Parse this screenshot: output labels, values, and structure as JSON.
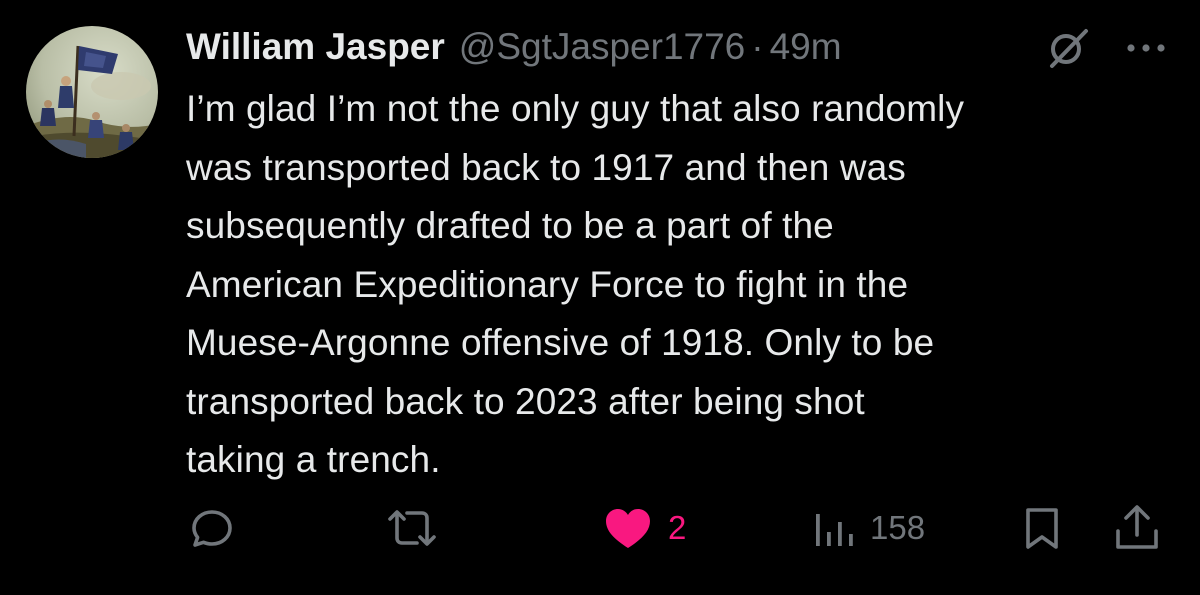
{
  "tweet": {
    "author": {
      "display_name": "William Jasper",
      "handle": "@SgtJasper1776",
      "separator": "·",
      "time": "49m"
    },
    "text_lines": [
      "I’m glad I’m not the only guy that also randomly",
      "was transported back to 1917 and then was",
      "subsequently drafted to be a part of the",
      "American Expeditionary Force to fight in the",
      "Muese-Argonne offensive of 1918. Only to be",
      "transported back to 2023 after being shot",
      "taking a trench."
    ],
    "header_icons": [
      "grok-icon",
      "more-icon"
    ],
    "actions": {
      "reply": {
        "icon": "reply-icon",
        "count": ""
      },
      "retweet": {
        "icon": "retweet-icon",
        "count": ""
      },
      "like": {
        "icon": "heart-icon",
        "count": "2",
        "active": true
      },
      "views": {
        "icon": "views-icon",
        "count": "158"
      },
      "bookmark": {
        "icon": "bookmark-icon",
        "count": ""
      },
      "share": {
        "icon": "share-icon",
        "count": ""
      }
    }
  },
  "colors": {
    "background": "#000000",
    "primary_text": "#e7e9ea",
    "secondary_text": "#71767b",
    "like_pink": "#f91880"
  }
}
